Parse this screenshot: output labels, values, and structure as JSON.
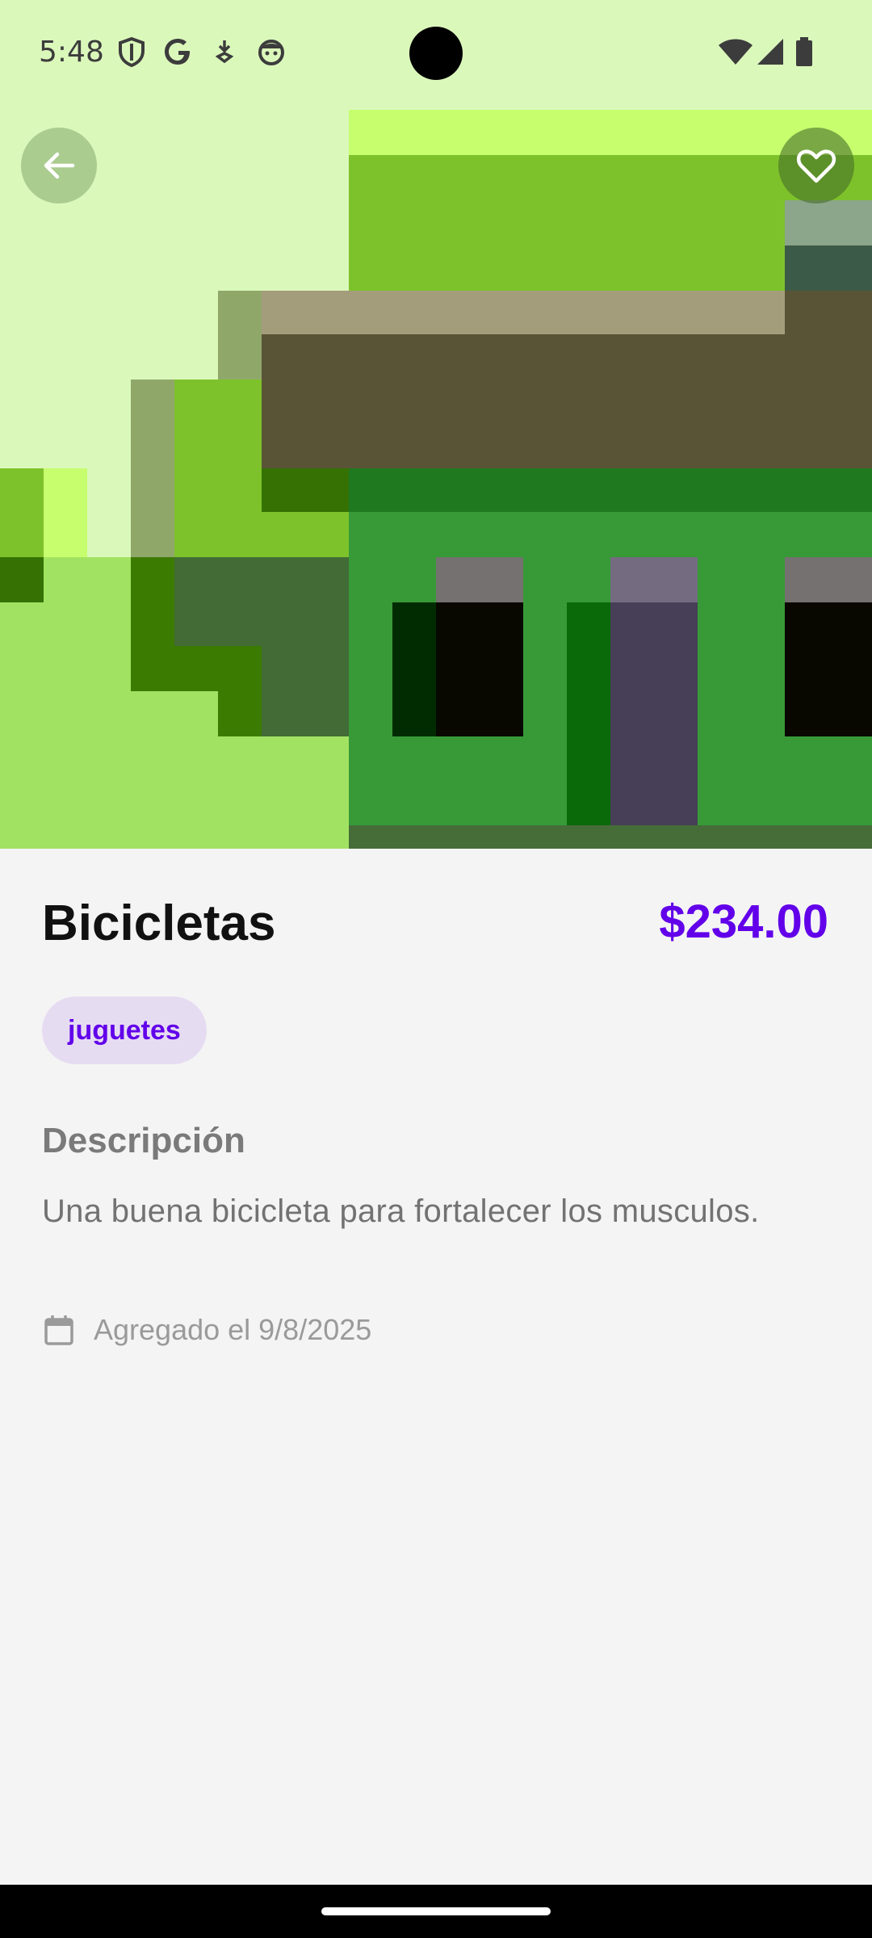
{
  "status_bar": {
    "time": "5:48",
    "left_icons": [
      "shield-icon",
      "google-g-icon",
      "download-arrow-icon",
      "face-icon"
    ],
    "right_icons": [
      "wifi-icon",
      "signal-icon",
      "battery-icon"
    ]
  },
  "header": {
    "back_icon": "arrow-left-icon",
    "favorite_icon": "heart-outline-icon"
  },
  "product": {
    "name": "Bicicletas",
    "price": "$234.00",
    "category": "juguetes",
    "description_heading": "Descripción",
    "description": "Una buena bicicleta para fortalecer los musculos.",
    "added_label": "Agregado el 9/8/2025"
  },
  "colors": {
    "accent": "#6200ea",
    "chip_bg": "#e6dcf2",
    "status_bar_bg": "#dbf8bb",
    "page_bg": "#f4f4f4"
  }
}
